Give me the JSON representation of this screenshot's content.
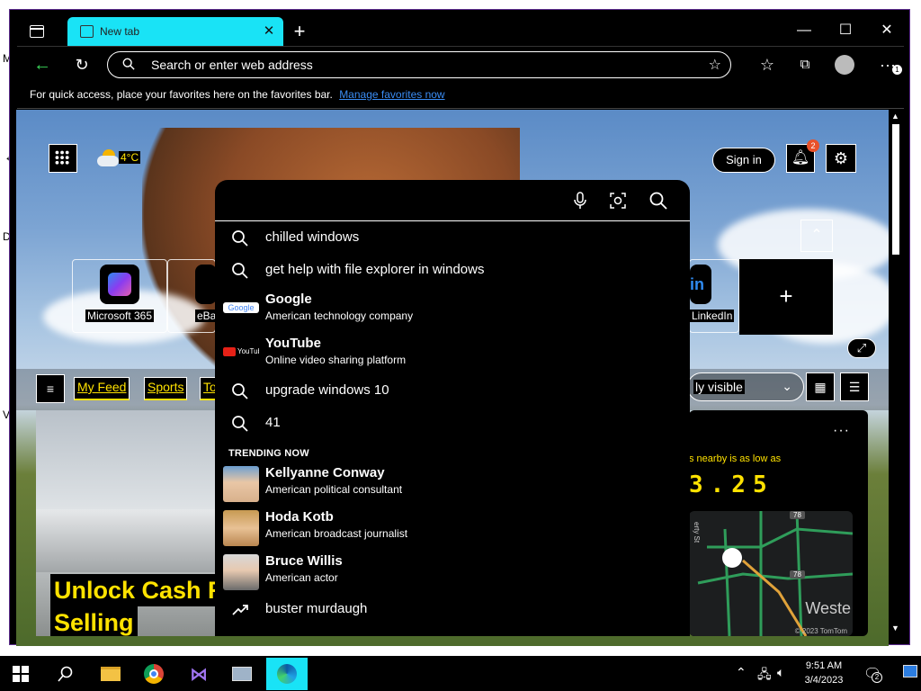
{
  "desktop": {
    "letters": [
      "M",
      "D",
      "V"
    ]
  },
  "browser": {
    "tab": {
      "title": "New tab"
    },
    "address": {
      "placeholder": "Search or enter web address"
    },
    "favorites_bar": {
      "text": "For quick access, place your favorites here on the favorites bar.",
      "link": "Manage favorites now"
    },
    "more_badge": "1"
  },
  "newtab": {
    "weather": "4°C",
    "sign_in": "Sign in",
    "notifications_count": "2",
    "tiles": [
      {
        "label": "Microsoft 365"
      },
      {
        "label": "eBay"
      },
      {
        "label": "LinkedIn"
      }
    ],
    "feed_tabs": [
      "My Feed",
      "Sports",
      "To"
    ],
    "visibility": "ly visible",
    "headline": "Unlock Cash Fr\nSelling",
    "headline_line1": "Unlock Cash Fr",
    "headline_line2": "Selling",
    "gas_text": "s nearby is as low as",
    "gas_price": "3.25",
    "map_label": "Weste",
    "map_copy": "© 2023 TomTom",
    "map_route_labels": [
      "78",
      "78"
    ],
    "map_street": "erty St"
  },
  "search_dropdown": {
    "suggestions_top": [
      "chilled windows",
      "get help with file explorer in windows"
    ],
    "entities_top": [
      {
        "title": "Google",
        "desc": "American technology company",
        "thumb": "google-logo"
      },
      {
        "title": "YouTube",
        "desc": "Online video sharing platform",
        "thumb": "youtube-logo"
      }
    ],
    "suggestions_mid": [
      "upgrade windows 10",
      "41"
    ],
    "trending_header": "TRENDING NOW",
    "trending": [
      {
        "title": "Kellyanne Conway",
        "desc": "American political consultant"
      },
      {
        "title": "Hoda Kotb",
        "desc": "American broadcast journalist"
      },
      {
        "title": "Bruce Willis",
        "desc": "American actor"
      }
    ],
    "trending_query": "buster murdaugh"
  },
  "taskbar": {
    "time": "9:51 AM",
    "date": "3/4/2023",
    "notification_count": "2"
  }
}
